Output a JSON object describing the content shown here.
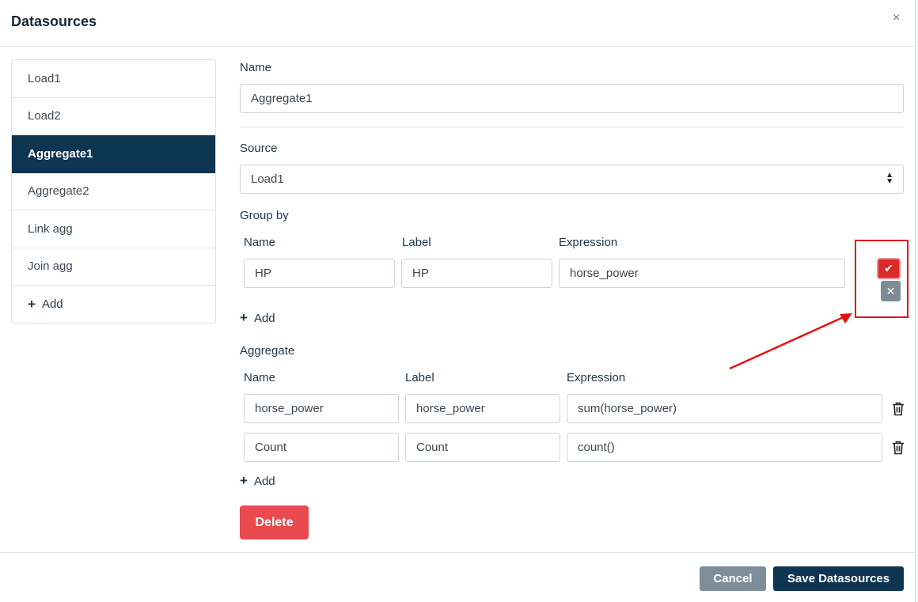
{
  "modal": {
    "title": "Datasources",
    "close": "×"
  },
  "sidebar": {
    "items": [
      {
        "label": "Load1"
      },
      {
        "label": "Load2"
      },
      {
        "label": "Aggregate1",
        "active": true
      },
      {
        "label": "Aggregate2"
      },
      {
        "label": "Link agg"
      },
      {
        "label": "Join agg"
      }
    ],
    "add_label": "Add"
  },
  "form": {
    "name_label": "Name",
    "name_value": "Aggregate1",
    "source_label": "Source",
    "source_value": "Load1",
    "group_by": {
      "title": "Group by",
      "headers": {
        "name": "Name",
        "label": "Label",
        "expression": "Expression"
      },
      "rows": [
        {
          "name": "HP",
          "label": "HP",
          "expression": "horse_power"
        }
      ],
      "add_label": "Add"
    },
    "aggregate": {
      "title": "Aggregate",
      "headers": {
        "name": "Name",
        "label": "Label",
        "expression": "Expression"
      },
      "rows": [
        {
          "name": "horse_power",
          "label": "horse_power",
          "expression": "sum(horse_power)"
        },
        {
          "name": "Count",
          "label": "Count",
          "expression": "count()"
        }
      ],
      "add_label": "Add"
    },
    "delete_label": "Delete"
  },
  "footer": {
    "cancel_label": "Cancel",
    "save_label": "Save Datasources"
  },
  "colors": {
    "primary": "#0d3451",
    "danger": "#e84a4f",
    "secondary": "#7d8d99",
    "annotation": "#e01414"
  }
}
